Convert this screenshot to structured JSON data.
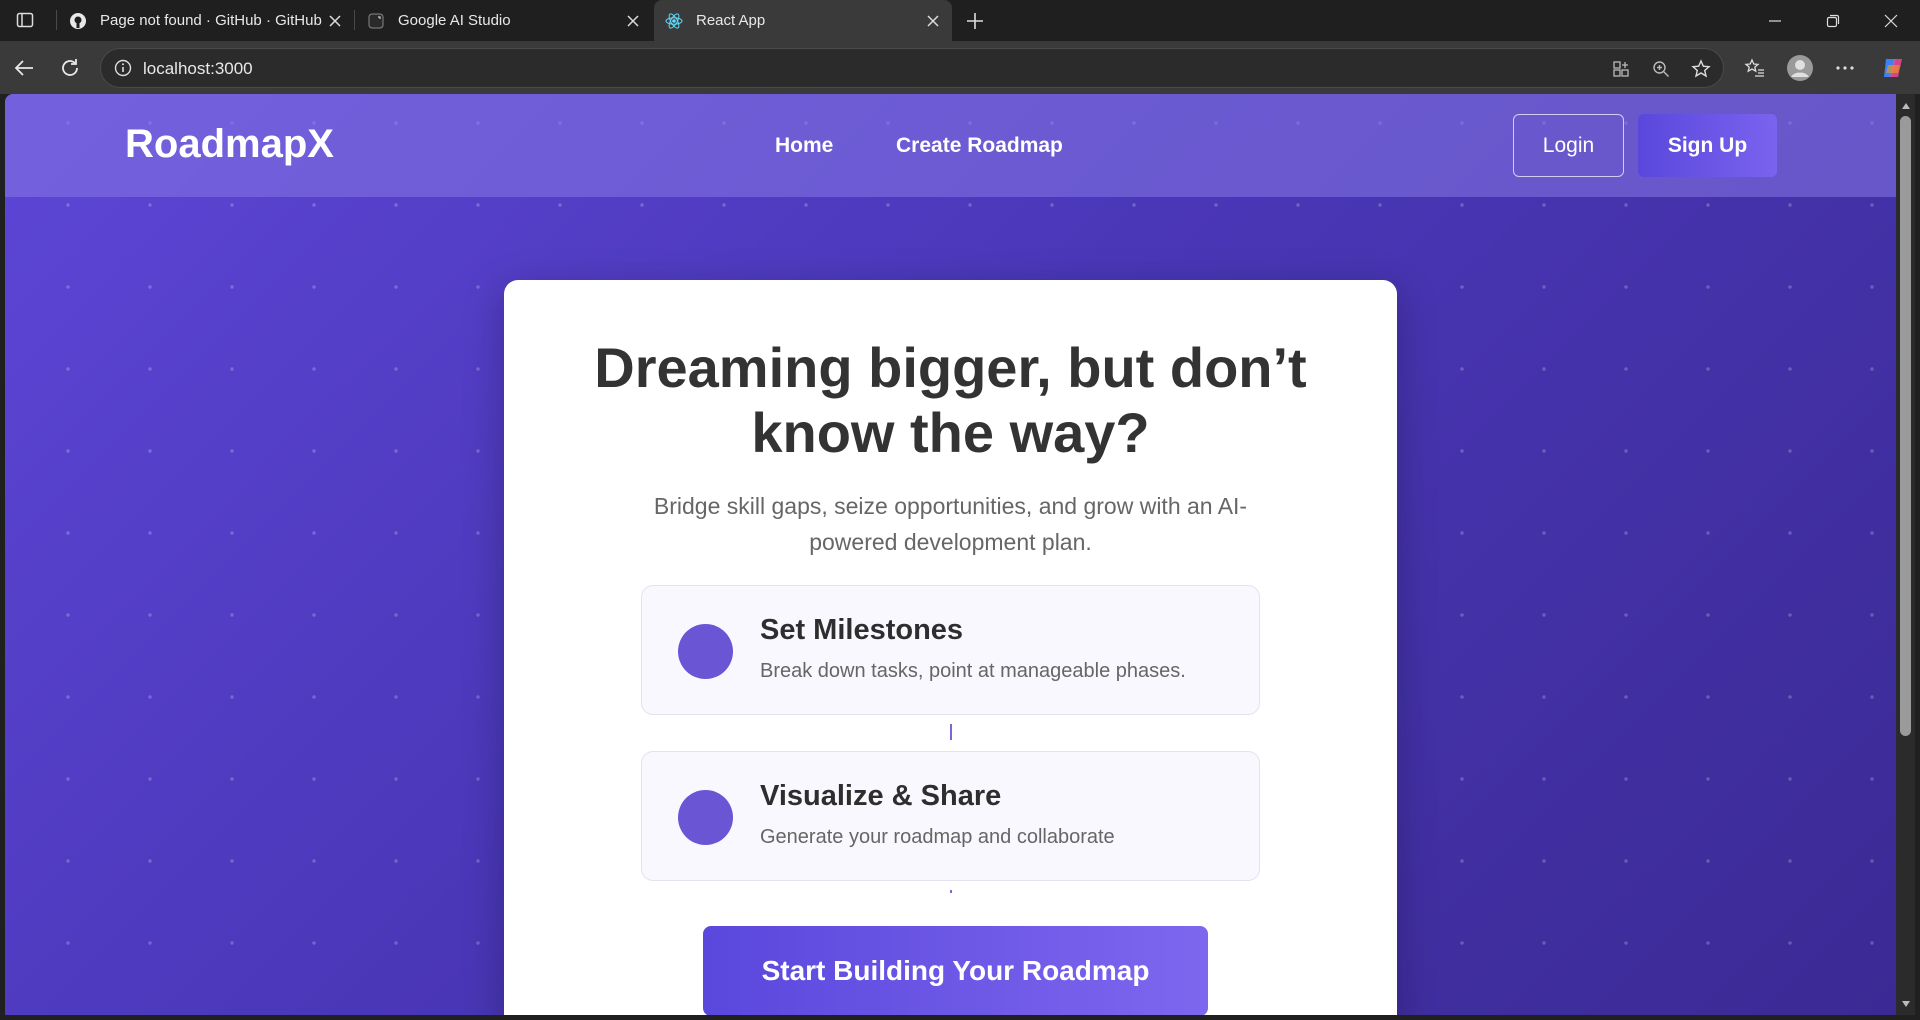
{
  "browser": {
    "tabs": [
      {
        "title": "Page not found · GitHub · GitHub",
        "icon": "github-icon",
        "active": false
      },
      {
        "title": "Google AI Studio",
        "icon": "ai-studio-icon",
        "active": false
      },
      {
        "title": "React App",
        "icon": "react-icon",
        "active": true
      }
    ],
    "address": "localhost:3000"
  },
  "nav": {
    "logo": "RoadmapX",
    "links": [
      "Home",
      "Create Roadmap"
    ],
    "login": "Login",
    "signup": "Sign Up"
  },
  "hero": {
    "title": "Dreaming bigger, but don’t know the way?",
    "subtitle": "Bridge skill gaps, seize opportunities, and grow with an AI-powered development plan.",
    "features": [
      {
        "title": "Set Milestones",
        "description": "Break down tasks, point at manageable phases."
      },
      {
        "title": "Visualize & Share",
        "description": "Generate your roadmap and collaborate"
      }
    ],
    "cta": "Start Building Your Roadmap"
  },
  "colors": {
    "accent": "#5a47dc",
    "background_start": "#5d46d6",
    "background_end": "#3b2a94"
  }
}
